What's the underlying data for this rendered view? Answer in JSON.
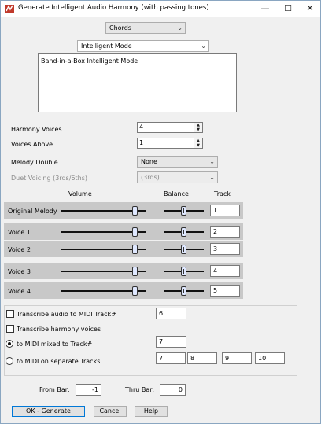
{
  "window": {
    "title": "Generate Intelligent Audio Harmony (with passing tones)",
    "minimize": "—",
    "maximize": "☐",
    "close": "✕"
  },
  "top": {
    "type_combo": "Chords",
    "mode_combo": "Intelligent Mode",
    "description": "Band-in-a-Box Intelligent Mode"
  },
  "settings": {
    "harmony_voices_label": "Harmony Voices",
    "harmony_voices_value": "4",
    "voices_above_label": "Voices Above",
    "voices_above_value": "1",
    "melody_double_label": "Melody Double",
    "melody_double_value": "None",
    "duet_voicing_label": "Duet Voicing (3rds/6ths)",
    "duet_voicing_value": "(3rds)"
  },
  "mixer": {
    "headers": {
      "volume": "Volume",
      "balance": "Balance",
      "track": "Track"
    },
    "rows": [
      {
        "label": "Original Melody",
        "track": "1",
        "volume": 0.93,
        "balance": 0.5
      },
      {
        "label": "Voice 1",
        "track": "2",
        "volume": 0.93,
        "balance": 0.5
      },
      {
        "label": "Voice 2",
        "track": "3",
        "volume": 0.93,
        "balance": 0.5
      },
      {
        "label": "Voice 3",
        "track": "4",
        "volume": 0.93,
        "balance": 0.5
      },
      {
        "label": "Voice 4",
        "track": "5",
        "volume": 0.93,
        "balance": 0.5
      }
    ]
  },
  "output": {
    "transcribe_audio_label": "Transcribe audio to MIDI Track#",
    "transcribe_audio_track": "6",
    "transcribe_harmony_label": "Transcribe harmony voices",
    "midi_mixed_label": "to MIDI mixed to Track#",
    "midi_mixed_track": "7",
    "midi_separate_label": "to MIDI on separate Tracks",
    "midi_separate_tracks": [
      "7",
      "8",
      "9",
      "10"
    ]
  },
  "range": {
    "from_bar_label_pre": "F",
    "from_bar_label_post": "rom Bar:",
    "from_bar_value": "-1",
    "thru_bar_label_pre": "T",
    "thru_bar_label_post": "hru Bar:",
    "thru_bar_value": "0"
  },
  "buttons": {
    "ok": "OK - Generate",
    "cancel": "Cancel",
    "help": "Help"
  }
}
